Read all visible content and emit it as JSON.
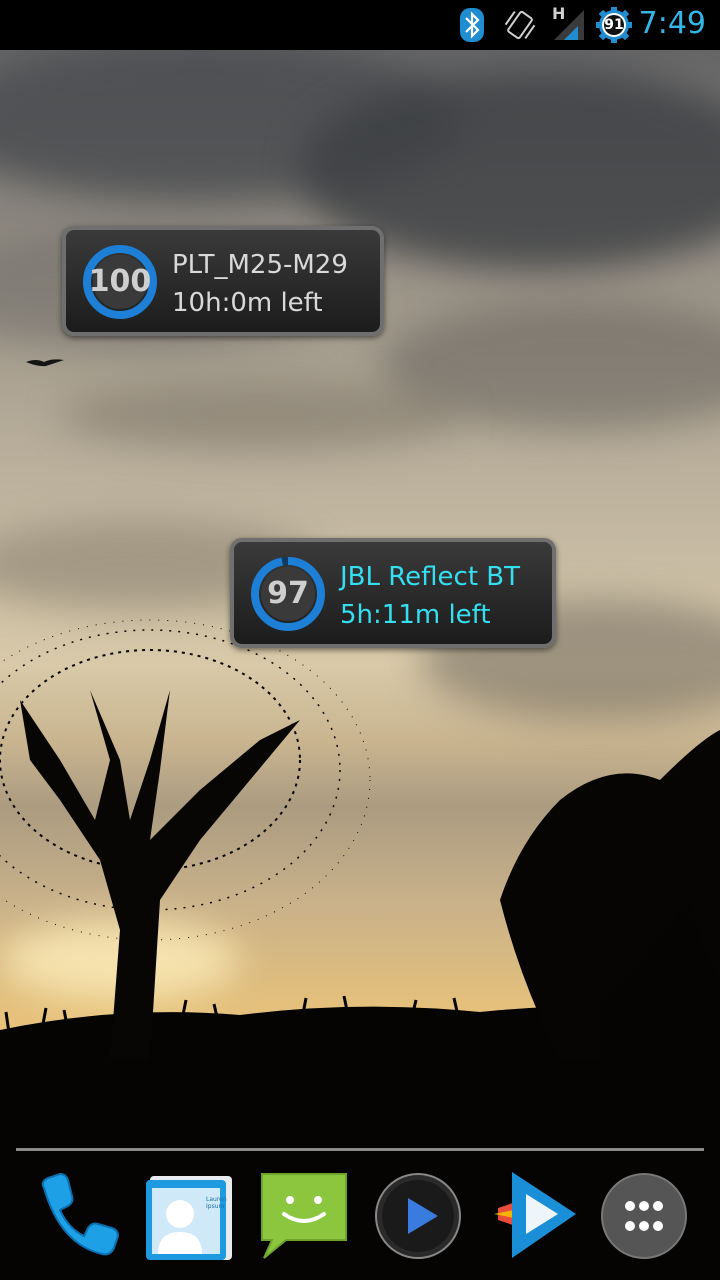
{
  "status_bar": {
    "time": "7:49",
    "battery_level": "91",
    "network_type": "H",
    "icons": [
      "bluetooth-icon",
      "vibrate-icon",
      "signal-icon",
      "battery-gear-icon"
    ]
  },
  "widgets": [
    {
      "level": "100",
      "level_fraction": 1.0,
      "device_name": "PLT_M25-M29",
      "time_left": "10h:0m left",
      "text_color": "#d9d9d9"
    },
    {
      "level": "97",
      "level_fraction": 0.97,
      "device_name": "JBL Reflect BT",
      "time_left": "5h:11m left",
      "text_color": "#33dff0"
    }
  ],
  "dock": {
    "apps": [
      "phone-icon",
      "contacts-icon",
      "messaging-icon",
      "music-player-icon",
      "play-store-icon",
      "app-drawer-icon"
    ],
    "contacts_card_text": "Lauren Ipsum"
  },
  "colors": {
    "accent": "#33b5e5",
    "ring": "#1e7fd6"
  }
}
